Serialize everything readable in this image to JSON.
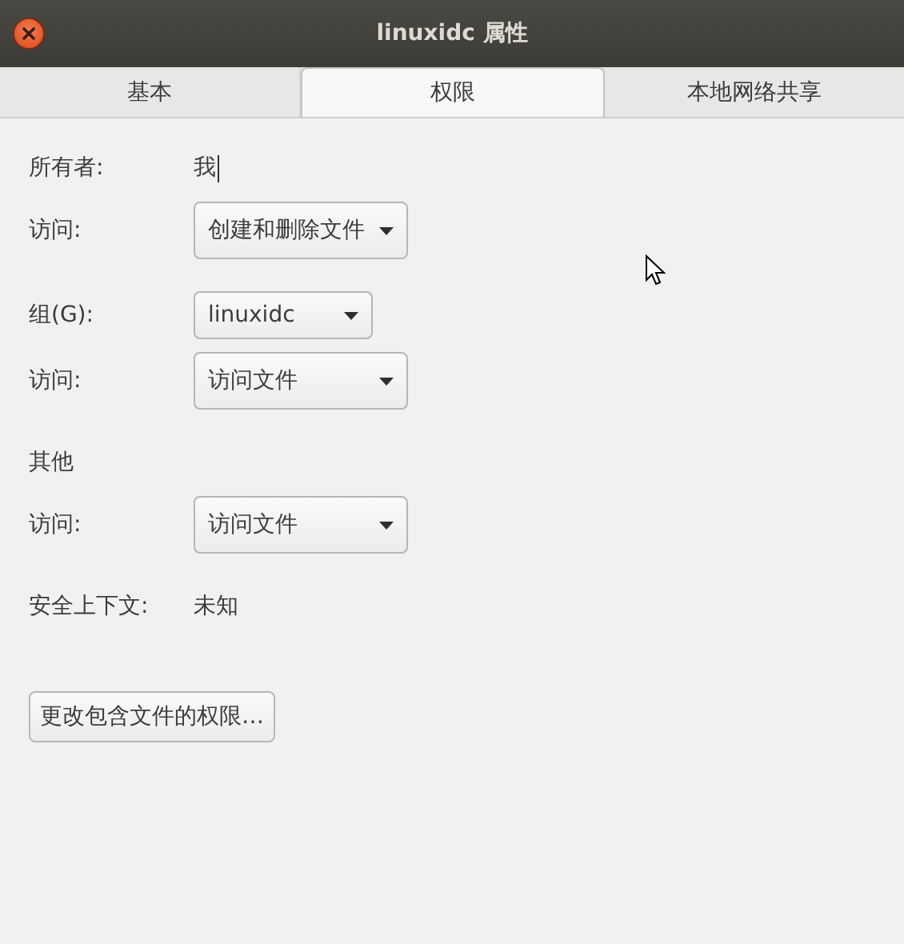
{
  "window": {
    "title": "linuxidc 属性"
  },
  "tabs": [
    {
      "label": "基本",
      "selected": false
    },
    {
      "label": "权限",
      "selected": true
    },
    {
      "label": "本地网络共享",
      "selected": false
    }
  ],
  "sections": [
    {
      "rows": [
        {
          "kind": "text",
          "label": "所有者:",
          "value": "我"
        },
        {
          "kind": "dropdown",
          "label": "访问:",
          "value": "创建和删除文件"
        }
      ]
    },
    {
      "rows": [
        {
          "kind": "dropdown",
          "label": "组(G):",
          "value": "linuxidc"
        },
        {
          "kind": "dropdown",
          "label": "访问:",
          "value": "访问文件"
        }
      ]
    },
    {
      "rows": [
        {
          "kind": "heading",
          "label": "其他"
        },
        {
          "kind": "dropdown",
          "label": "访问:",
          "value": "访问文件"
        }
      ]
    },
    {
      "rows": [
        {
          "kind": "text",
          "label": "安全上下文:",
          "value": "未知"
        }
      ]
    }
  ],
  "button": "更改包含文件的权限…"
}
